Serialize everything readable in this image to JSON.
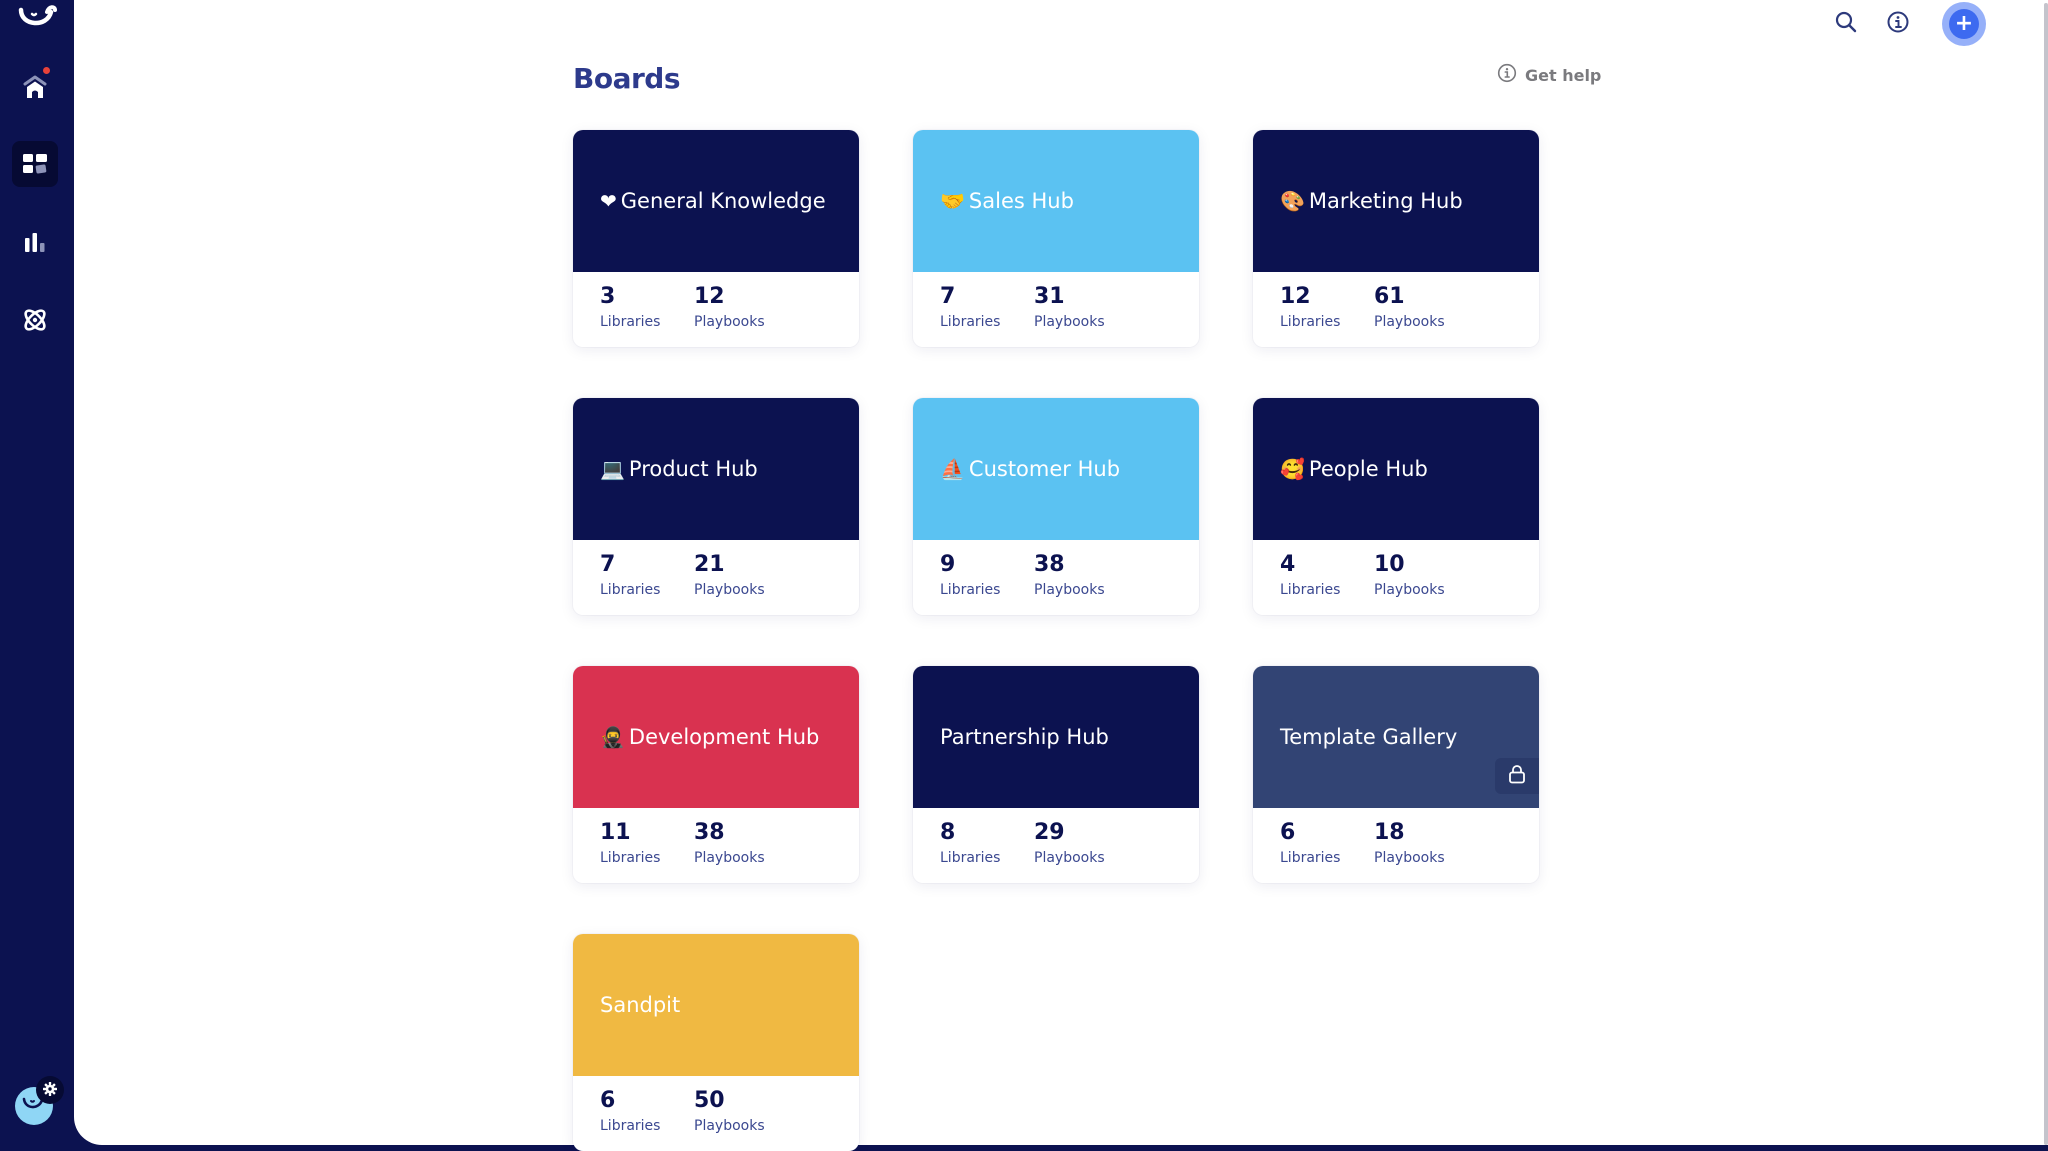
{
  "sidebar": {
    "logo": "smile-logo-icon",
    "items": [
      {
        "name": "home",
        "icon": "home-icon",
        "active": false,
        "notification": true
      },
      {
        "name": "boards",
        "icon": "boards-grid-icon",
        "active": true,
        "notification": false
      },
      {
        "name": "analytics",
        "icon": "bar-chart-icon",
        "active": false,
        "notification": false
      },
      {
        "name": "integrations",
        "icon": "atom-icon",
        "active": false,
        "notification": false
      }
    ],
    "user_avatar": "user-avatar-icon",
    "settings": "gear-icon"
  },
  "topbar": {
    "search_icon": "search-icon",
    "info_icon": "info-icon",
    "add_button": "+"
  },
  "page": {
    "title": "Boards",
    "get_help": "Get help"
  },
  "colors": {
    "navy": "#0c1250",
    "sky": "#5bc2f2",
    "red": "#d93250",
    "slate": "#324474",
    "yellow": "#f0b942",
    "accent": "#3d6af0"
  },
  "stat_labels": {
    "libraries": "Libraries",
    "playbooks": "Playbooks"
  },
  "boards": [
    {
      "emoji": "❤",
      "name": "General Knowledge",
      "color": "#0c1250",
      "libraries": "3",
      "playbooks": "12",
      "locked": false
    },
    {
      "emoji": "🤝",
      "name": "Sales Hub",
      "color": "#5bc2f2",
      "libraries": "7",
      "playbooks": "31",
      "locked": false
    },
    {
      "emoji": "🎨",
      "name": "Marketing Hub",
      "color": "#0c1250",
      "libraries": "12",
      "playbooks": "61",
      "locked": false
    },
    {
      "emoji": "💻",
      "name": "Product Hub",
      "color": "#0c1250",
      "libraries": "7",
      "playbooks": "21",
      "locked": false
    },
    {
      "emoji": "⛵",
      "name": "Customer Hub",
      "color": "#5bc2f2",
      "libraries": "9",
      "playbooks": "38",
      "locked": false
    },
    {
      "emoji": "🥰",
      "name": "People Hub",
      "color": "#0c1250",
      "libraries": "4",
      "playbooks": "10",
      "locked": false
    },
    {
      "emoji": "🥷",
      "name": "Development Hub",
      "color": "#d93250",
      "libraries": "11",
      "playbooks": "38",
      "locked": false
    },
    {
      "emoji": "",
      "name": "Partnership Hub",
      "color": "#0c1250",
      "libraries": "8",
      "playbooks": "29",
      "locked": false
    },
    {
      "emoji": "",
      "name": "Template Gallery",
      "color": "#324474",
      "libraries": "6",
      "playbooks": "18",
      "locked": true
    },
    {
      "emoji": "",
      "name": "Sandpit",
      "color": "#f0b942",
      "libraries": "6",
      "playbooks": "50",
      "locked": false
    }
  ]
}
